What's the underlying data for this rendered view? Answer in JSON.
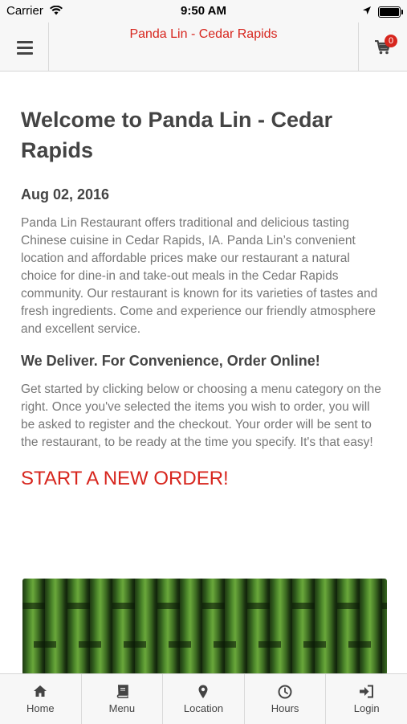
{
  "status_bar": {
    "carrier": "Carrier",
    "time": "9:50 AM"
  },
  "nav": {
    "title": "Panda Lin - Cedar Rapids",
    "cart_count": "0"
  },
  "content": {
    "welcome_title": "Welcome to Panda Lin - Cedar Rapids",
    "date": "Aug 02, 2016",
    "intro": "Panda Lin Restaurant offers traditional and delicious tasting Chinese cuisine in Cedar Rapids, IA. Panda Lin’s convenient location and affordable prices make our restaurant a natural choice for dine-in and take-out meals in the Cedar Rapids community. Our restaurant is known for its varieties of tastes and fresh ingredients. Come and experience our friendly atmosphere and excellent service.",
    "deliver_heading": "We Deliver. For Convenience, Order Online!",
    "instructions": "Get started by clicking below or choosing a menu category on the right. Once you've selected the items you wish to order, you will be asked to register and the checkout. Your order will be sent to the restaurant, to be ready at the time you specify. It's that easy!",
    "order_link": "START A NEW ORDER!"
  },
  "tabs": [
    {
      "label": "Home",
      "icon": "home-icon"
    },
    {
      "label": "Menu",
      "icon": "book-icon"
    },
    {
      "label": "Location",
      "icon": "map-pin-icon"
    },
    {
      "label": "Hours",
      "icon": "clock-icon"
    },
    {
      "label": "Login",
      "icon": "sign-in-icon"
    }
  ],
  "colors": {
    "accent": "#d7261e",
    "text": "#444444",
    "body_text": "#777777",
    "bar_bg": "#f7f7f7"
  }
}
